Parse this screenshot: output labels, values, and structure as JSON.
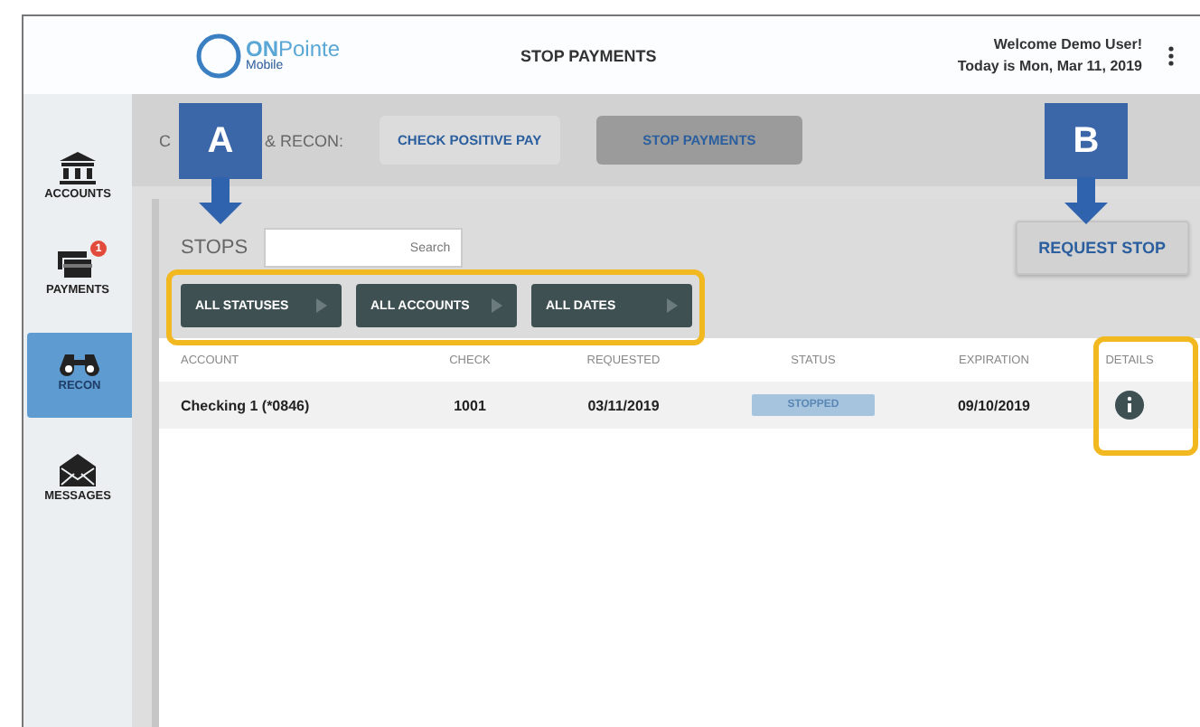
{
  "header": {
    "logo": {
      "brand": "**ON**Pointe",
      "product": "Mobile"
    },
    "title": "STOP PAYMENTS",
    "welcome": "Welcome Demo User!",
    "date": "Today is Mon, Mar 11, 2019"
  },
  "sidebar": {
    "items": [
      {
        "label": "ACCOUNTS",
        "kind": "bank",
        "selected": false
      },
      {
        "label": "PAYMENTS",
        "kind": "payments",
        "selected": false,
        "badge": "1"
      },
      {
        "label": "RECON",
        "kind": "binoculars",
        "selected": true
      },
      {
        "label": "MESSAGES",
        "kind": "mail",
        "selected": false
      }
    ]
  },
  "subnav": {
    "label_start": "C",
    "label_end": "& RECON:",
    "tabs": [
      {
        "label": "CHECK POSITIVE PAY",
        "selected": false
      },
      {
        "label": "STOP PAYMENTS",
        "selected": true
      }
    ]
  },
  "stops": {
    "title": "STOPS",
    "search": {
      "placeholder": "Search"
    },
    "request_button": "REQUEST STOP",
    "filters": [
      "ALL STATUSES",
      "ALL ACCOUNTS",
      "ALL DATES"
    ]
  },
  "table": {
    "columns": [
      "ACCOUNT",
      "CHECK",
      "REQUESTED",
      "STATUS",
      "EXPIRATION",
      "DETAILS"
    ],
    "rows": [
      {
        "account": "Checking 1 (*0846)",
        "check": "1001",
        "requested": "03/11/2019",
        "status": "STOPPED",
        "expiration": "09/10/2019"
      }
    ]
  },
  "callouts": [
    {
      "letter": "A"
    },
    {
      "letter": "B"
    }
  ]
}
